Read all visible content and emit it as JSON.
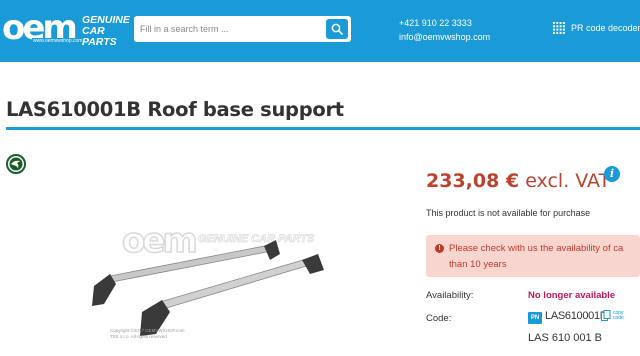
{
  "header": {
    "logo_text": "oem",
    "logo_domain": "www.oemvwshop.com",
    "logo_tagline_1": "GENUINE",
    "logo_tagline_2": "CAR PARTS",
    "search_placeholder": "Fill in a search term ...",
    "phone": "+421 910 22 3333",
    "email": "info@oemvwshop.com",
    "pr_code_label": "PR code decoder"
  },
  "product": {
    "title": "LAS610001B Roof base support",
    "brand_icon": "skoda-logo-icon",
    "image_watermark_brand": "GENUINE CAR PARTS",
    "image_copyright_1": "Copyright ©2017 OEMVWSHOP.com",
    "image_copyright_2": "TEE s.r.o. All rights reserved"
  },
  "price": {
    "amount": "233,08 €",
    "suffix": "excl. VAT",
    "unavailable_note": "This product is not available for purchase"
  },
  "alert": {
    "line_1": "Please check with us the availability of ca",
    "line_2": "than 10 years"
  },
  "details": {
    "availability_label": "Availability:",
    "availability_value": "No longer available",
    "code_label": "Code:",
    "code_badge": "PN",
    "code_value": "LAS610001B",
    "copy_label_1": "copy",
    "copy_label_2": "code",
    "code_alt": "LAS 610 001 B"
  },
  "colors": {
    "brand_blue": "#1a9ad6",
    "price_red": "#b9432f",
    "alert_bg": "#f8d6cf",
    "alert_text": "#c0392b",
    "unavailable_pink": "#c2185b"
  }
}
